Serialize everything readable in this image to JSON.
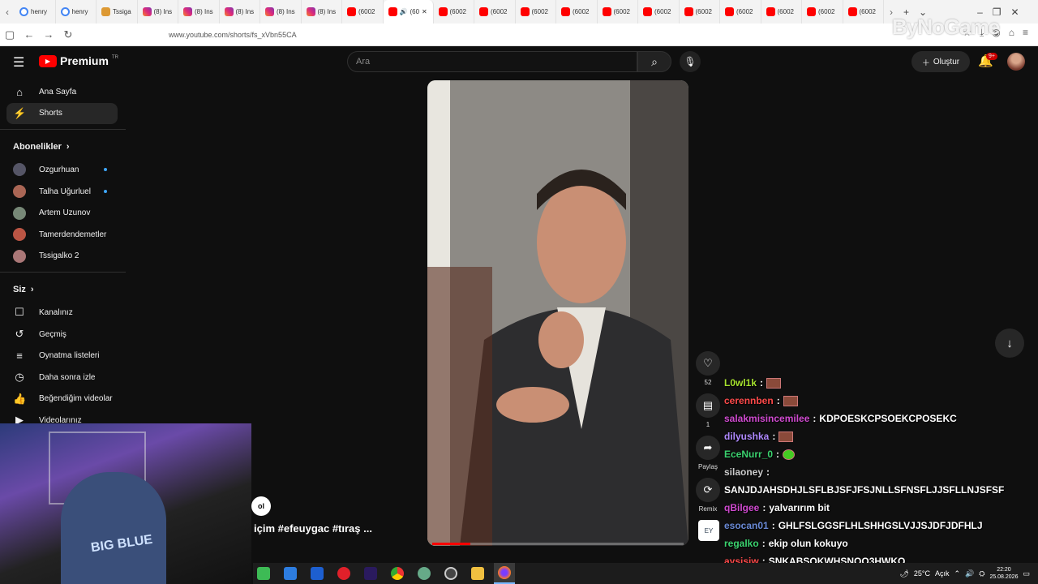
{
  "browser": {
    "tabs": [
      {
        "label": "henry",
        "icon": "google-icon"
      },
      {
        "label": "henry",
        "icon": "google-icon"
      },
      {
        "label": "Tssiga",
        "icon": "tssigalko-icon"
      },
      {
        "label": "(8) Ins",
        "icon": "instagram-icon"
      },
      {
        "label": "(8) Ins",
        "icon": "instagram-icon"
      },
      {
        "label": "(8) Ins",
        "icon": "instagram-icon"
      },
      {
        "label": "(8) Ins",
        "icon": "instagram-icon"
      },
      {
        "label": "(8) Ins",
        "icon": "instagram-icon"
      },
      {
        "label": "(6002",
        "icon": "youtube-icon"
      },
      {
        "label": "(60",
        "icon": "youtube-icon",
        "active": true
      },
      {
        "label": "(6002",
        "icon": "youtube-icon"
      },
      {
        "label": "(6002",
        "icon": "youtube-icon"
      },
      {
        "label": "(6002",
        "icon": "youtube-icon"
      },
      {
        "label": "(6002",
        "icon": "youtube-icon"
      },
      {
        "label": "(6002",
        "icon": "youtube-icon"
      },
      {
        "label": "(6002",
        "icon": "youtube-icon"
      },
      {
        "label": "(6002",
        "icon": "youtube-icon"
      },
      {
        "label": "(6002",
        "icon": "youtube-icon"
      },
      {
        "label": "(6002",
        "icon": "youtube-icon"
      },
      {
        "label": "(6002",
        "icon": "youtube-icon"
      },
      {
        "label": "(6002",
        "icon": "youtube-icon"
      }
    ],
    "url": "www.youtube.com/shorts/fs_xVbn55CA",
    "watermark": "ByNoGame"
  },
  "header": {
    "logo": "Premium",
    "region": "TR",
    "search_placeholder": "Ara",
    "create_label": "Oluştur",
    "notif_badge": "9+"
  },
  "sidebar": {
    "main": [
      {
        "label": "Ana Sayfa",
        "icon": "home-icon"
      },
      {
        "label": "Shorts",
        "icon": "shorts-icon",
        "active": true
      }
    ],
    "subs_title": "Abonelikler",
    "subs": [
      {
        "label": "Ozgurhuan",
        "dot": true,
        "color": "#556"
      },
      {
        "label": "Talha Uğurluel",
        "dot": true,
        "color": "#a65"
      },
      {
        "label": "Artem Uzunov",
        "dot": false,
        "color": "#787"
      },
      {
        "label": "Tamerdendemetler",
        "dot": false,
        "color": "#b54"
      },
      {
        "label": "Tssigalko 2",
        "dot": false,
        "color": "#a77"
      }
    ],
    "you_title": "Siz",
    "you": [
      {
        "label": "Kanalınız",
        "icon": "channel-icon"
      },
      {
        "label": "Geçmiş",
        "icon": "history-icon"
      },
      {
        "label": "Oynatma listeleri",
        "icon": "playlist-icon"
      },
      {
        "label": "Daha sonra izle",
        "icon": "clock-icon"
      },
      {
        "label": "Beğendiğim videolar",
        "icon": "thumbs-up-icon"
      },
      {
        "label": "Videolarınız",
        "icon": "video-icon"
      }
    ]
  },
  "short": {
    "like_count": "52",
    "comment_count": "1",
    "share_label": "Paylaş",
    "remix_label": "Remix",
    "caption": "içim #efeuygac #tıraş ...",
    "subscribe_stub": "ol",
    "progress": 0.15,
    "channel_badge": "EY"
  },
  "chat": [
    {
      "user": "L0wl1k",
      "color": "#a6e22e",
      "text": "",
      "emote": true
    },
    {
      "user": "cerennben",
      "color": "#ff4a4a",
      "text": "",
      "emote": true
    },
    {
      "user": "salakmisincemilee",
      "color": "#d04ad0",
      "text": "KDPOESKCPSOEKCPOSEKC",
      "emote": false
    },
    {
      "user": "dilyushka",
      "color": "#b08aff",
      "text": "",
      "emote": true
    },
    {
      "user": "EceNurr_0",
      "color": "#3bd36f",
      "text": "",
      "emote": true
    },
    {
      "user": "silaoney",
      "color": "#cccccc",
      "text": "",
      "emote": false
    },
    {
      "user": "",
      "color": "#ffffff",
      "text": "SANJDJAHSDHJLSFLBJSFJFSJNLLSFNSFLJJSFLLNJSFSF",
      "emote": false
    },
    {
      "user": "qBilgee",
      "color": "#d04ad0",
      "text": "yalvarırım bit",
      "emote": false
    },
    {
      "user": "esocan01",
      "color": "#6a8ad6",
      "text": "GHLFSLGGSFLHLSHHGSLVJJSJDFJDFHLJ",
      "emote": false
    },
    {
      "user": "regalko",
      "color": "#3bd36f",
      "text": "ekip olun kokuyo",
      "emote": false
    },
    {
      "user": "aysisiw",
      "color": "#ff4a4a",
      "text": "SNKABSQKWHSNQO3HWKQ",
      "emote": false
    }
  ],
  "webcam": {
    "shirt_text": "BIG BLUE"
  },
  "taskbar": {
    "weather": "25°C",
    "weather_desc": "Açık",
    "time": "22:20",
    "date": "25.08.2026"
  }
}
